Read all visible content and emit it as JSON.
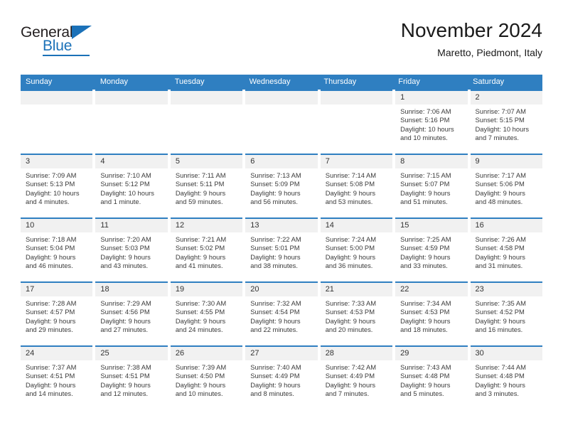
{
  "brand": {
    "general": "General",
    "blue": "Blue",
    "triangle_color": "#1b71b8",
    "text_color": "#231f20"
  },
  "header": {
    "title": "November 2024",
    "subtitle": "Maretto, Piedmont, Italy"
  },
  "theme": {
    "header_blue": "#2f7fc1",
    "daynum_bg": "#f1f1f1",
    "text": "#3a3a3a"
  },
  "weekdays": [
    "Sunday",
    "Monday",
    "Tuesday",
    "Wednesday",
    "Thursday",
    "Friday",
    "Saturday"
  ],
  "weeks": [
    [
      {
        "empty": true
      },
      {
        "empty": true
      },
      {
        "empty": true
      },
      {
        "empty": true
      },
      {
        "empty": true
      },
      {
        "day": "1",
        "sunrise": "Sunrise: 7:06 AM",
        "sunset": "Sunset: 5:16 PM",
        "daylight1": "Daylight: 10 hours",
        "daylight2": "and 10 minutes."
      },
      {
        "day": "2",
        "sunrise": "Sunrise: 7:07 AM",
        "sunset": "Sunset: 5:15 PM",
        "daylight1": "Daylight: 10 hours",
        "daylight2": "and 7 minutes."
      }
    ],
    [
      {
        "day": "3",
        "sunrise": "Sunrise: 7:09 AM",
        "sunset": "Sunset: 5:13 PM",
        "daylight1": "Daylight: 10 hours",
        "daylight2": "and 4 minutes."
      },
      {
        "day": "4",
        "sunrise": "Sunrise: 7:10 AM",
        "sunset": "Sunset: 5:12 PM",
        "daylight1": "Daylight: 10 hours",
        "daylight2": "and 1 minute."
      },
      {
        "day": "5",
        "sunrise": "Sunrise: 7:11 AM",
        "sunset": "Sunset: 5:11 PM",
        "daylight1": "Daylight: 9 hours",
        "daylight2": "and 59 minutes."
      },
      {
        "day": "6",
        "sunrise": "Sunrise: 7:13 AM",
        "sunset": "Sunset: 5:09 PM",
        "daylight1": "Daylight: 9 hours",
        "daylight2": "and 56 minutes."
      },
      {
        "day": "7",
        "sunrise": "Sunrise: 7:14 AM",
        "sunset": "Sunset: 5:08 PM",
        "daylight1": "Daylight: 9 hours",
        "daylight2": "and 53 minutes."
      },
      {
        "day": "8",
        "sunrise": "Sunrise: 7:15 AM",
        "sunset": "Sunset: 5:07 PM",
        "daylight1": "Daylight: 9 hours",
        "daylight2": "and 51 minutes."
      },
      {
        "day": "9",
        "sunrise": "Sunrise: 7:17 AM",
        "sunset": "Sunset: 5:06 PM",
        "daylight1": "Daylight: 9 hours",
        "daylight2": "and 48 minutes."
      }
    ],
    [
      {
        "day": "10",
        "sunrise": "Sunrise: 7:18 AM",
        "sunset": "Sunset: 5:04 PM",
        "daylight1": "Daylight: 9 hours",
        "daylight2": "and 46 minutes."
      },
      {
        "day": "11",
        "sunrise": "Sunrise: 7:20 AM",
        "sunset": "Sunset: 5:03 PM",
        "daylight1": "Daylight: 9 hours",
        "daylight2": "and 43 minutes."
      },
      {
        "day": "12",
        "sunrise": "Sunrise: 7:21 AM",
        "sunset": "Sunset: 5:02 PM",
        "daylight1": "Daylight: 9 hours",
        "daylight2": "and 41 minutes."
      },
      {
        "day": "13",
        "sunrise": "Sunrise: 7:22 AM",
        "sunset": "Sunset: 5:01 PM",
        "daylight1": "Daylight: 9 hours",
        "daylight2": "and 38 minutes."
      },
      {
        "day": "14",
        "sunrise": "Sunrise: 7:24 AM",
        "sunset": "Sunset: 5:00 PM",
        "daylight1": "Daylight: 9 hours",
        "daylight2": "and 36 minutes."
      },
      {
        "day": "15",
        "sunrise": "Sunrise: 7:25 AM",
        "sunset": "Sunset: 4:59 PM",
        "daylight1": "Daylight: 9 hours",
        "daylight2": "and 33 minutes."
      },
      {
        "day": "16",
        "sunrise": "Sunrise: 7:26 AM",
        "sunset": "Sunset: 4:58 PM",
        "daylight1": "Daylight: 9 hours",
        "daylight2": "and 31 minutes."
      }
    ],
    [
      {
        "day": "17",
        "sunrise": "Sunrise: 7:28 AM",
        "sunset": "Sunset: 4:57 PM",
        "daylight1": "Daylight: 9 hours",
        "daylight2": "and 29 minutes."
      },
      {
        "day": "18",
        "sunrise": "Sunrise: 7:29 AM",
        "sunset": "Sunset: 4:56 PM",
        "daylight1": "Daylight: 9 hours",
        "daylight2": "and 27 minutes."
      },
      {
        "day": "19",
        "sunrise": "Sunrise: 7:30 AM",
        "sunset": "Sunset: 4:55 PM",
        "daylight1": "Daylight: 9 hours",
        "daylight2": "and 24 minutes."
      },
      {
        "day": "20",
        "sunrise": "Sunrise: 7:32 AM",
        "sunset": "Sunset: 4:54 PM",
        "daylight1": "Daylight: 9 hours",
        "daylight2": "and 22 minutes."
      },
      {
        "day": "21",
        "sunrise": "Sunrise: 7:33 AM",
        "sunset": "Sunset: 4:53 PM",
        "daylight1": "Daylight: 9 hours",
        "daylight2": "and 20 minutes."
      },
      {
        "day": "22",
        "sunrise": "Sunrise: 7:34 AM",
        "sunset": "Sunset: 4:53 PM",
        "daylight1": "Daylight: 9 hours",
        "daylight2": "and 18 minutes."
      },
      {
        "day": "23",
        "sunrise": "Sunrise: 7:35 AM",
        "sunset": "Sunset: 4:52 PM",
        "daylight1": "Daylight: 9 hours",
        "daylight2": "and 16 minutes."
      }
    ],
    [
      {
        "day": "24",
        "sunrise": "Sunrise: 7:37 AM",
        "sunset": "Sunset: 4:51 PM",
        "daylight1": "Daylight: 9 hours",
        "daylight2": "and 14 minutes."
      },
      {
        "day": "25",
        "sunrise": "Sunrise: 7:38 AM",
        "sunset": "Sunset: 4:51 PM",
        "daylight1": "Daylight: 9 hours",
        "daylight2": "and 12 minutes."
      },
      {
        "day": "26",
        "sunrise": "Sunrise: 7:39 AM",
        "sunset": "Sunset: 4:50 PM",
        "daylight1": "Daylight: 9 hours",
        "daylight2": "and 10 minutes."
      },
      {
        "day": "27",
        "sunrise": "Sunrise: 7:40 AM",
        "sunset": "Sunset: 4:49 PM",
        "daylight1": "Daylight: 9 hours",
        "daylight2": "and 8 minutes."
      },
      {
        "day": "28",
        "sunrise": "Sunrise: 7:42 AM",
        "sunset": "Sunset: 4:49 PM",
        "daylight1": "Daylight: 9 hours",
        "daylight2": "and 7 minutes."
      },
      {
        "day": "29",
        "sunrise": "Sunrise: 7:43 AM",
        "sunset": "Sunset: 4:48 PM",
        "daylight1": "Daylight: 9 hours",
        "daylight2": "and 5 minutes."
      },
      {
        "day": "30",
        "sunrise": "Sunrise: 7:44 AM",
        "sunset": "Sunset: 4:48 PM",
        "daylight1": "Daylight: 9 hours",
        "daylight2": "and 3 minutes."
      }
    ]
  ]
}
